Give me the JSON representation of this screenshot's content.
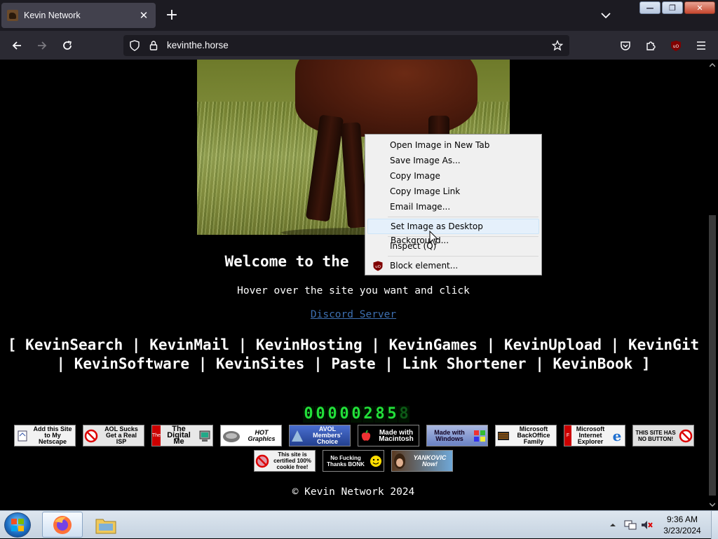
{
  "browser": {
    "tab_title": "Kevin Network",
    "url": "kevinthe.horse"
  },
  "page": {
    "welcome": "Welcome to the",
    "hover_text": "Hover over the site you want and click",
    "discord_link": "Discord Server",
    "services_open": "[",
    "services_close": "]",
    "services": [
      "KevinSearch",
      "KevinMail",
      "KevinHosting",
      "KevinGames",
      "KevinUpload",
      "KevinGit",
      "KevinSoftware",
      "KevinSites",
      "Paste",
      "Link Shortener",
      "KevinBook"
    ],
    "counter_digits": [
      "0",
      "0",
      "0",
      "0",
      "0",
      "2",
      "8",
      "5",
      "8"
    ],
    "badges_row1": [
      {
        "text": "Add this Site to My Netscape",
        "icon": "netscape-icon"
      },
      {
        "text": "AOL Sucks Get a Real ISP",
        "icon": "no-aol-icon"
      },
      {
        "text": "The Digital Me",
        "icon": "computer-icon"
      },
      {
        "text": "HOT Graphics",
        "icon": "hot-graphics-icon"
      },
      {
        "text": "AVOL Members' Choice",
        "icon": "avol-icon"
      },
      {
        "text": "Made with Macintosh",
        "icon": "apple-icon"
      },
      {
        "text": "Made with Windows",
        "icon": "windows-icon"
      },
      {
        "text": "Microsoft BackOffice Family",
        "icon": "backoffice-icon"
      },
      {
        "text": "Microsoft Internet Explorer",
        "icon": "ie-icon"
      },
      {
        "text": "THIS SITE HAS NO BUTTON!",
        "icon": "no-button-icon"
      }
    ],
    "badges_row2": [
      {
        "text": "This site is certified 100% cookie free!",
        "icon": "no-cookie-icon"
      },
      {
        "text": "No Fucking Thanks BONK",
        "icon": "bonk-icon"
      },
      {
        "text": "YANKOVIC Now!",
        "icon": "yankovic-icon"
      }
    ],
    "copyright": "© Kevin Network 2024"
  },
  "context_menu": {
    "items": [
      "Open Image in New Tab",
      "Save Image As...",
      "Copy Image",
      "Copy Image Link",
      "Email Image...",
      "Set Image as Desktop Background...",
      "Inspect (Q)",
      "Block element..."
    ],
    "highlighted": "Set Image as Desktop Background..."
  },
  "taskbar": {
    "time": "9:36 AM",
    "date": "3/23/2024"
  },
  "colors": {
    "counter_green": "#22e03a",
    "link_blue": "#3d6fb0",
    "ublock_red": "#800000"
  }
}
